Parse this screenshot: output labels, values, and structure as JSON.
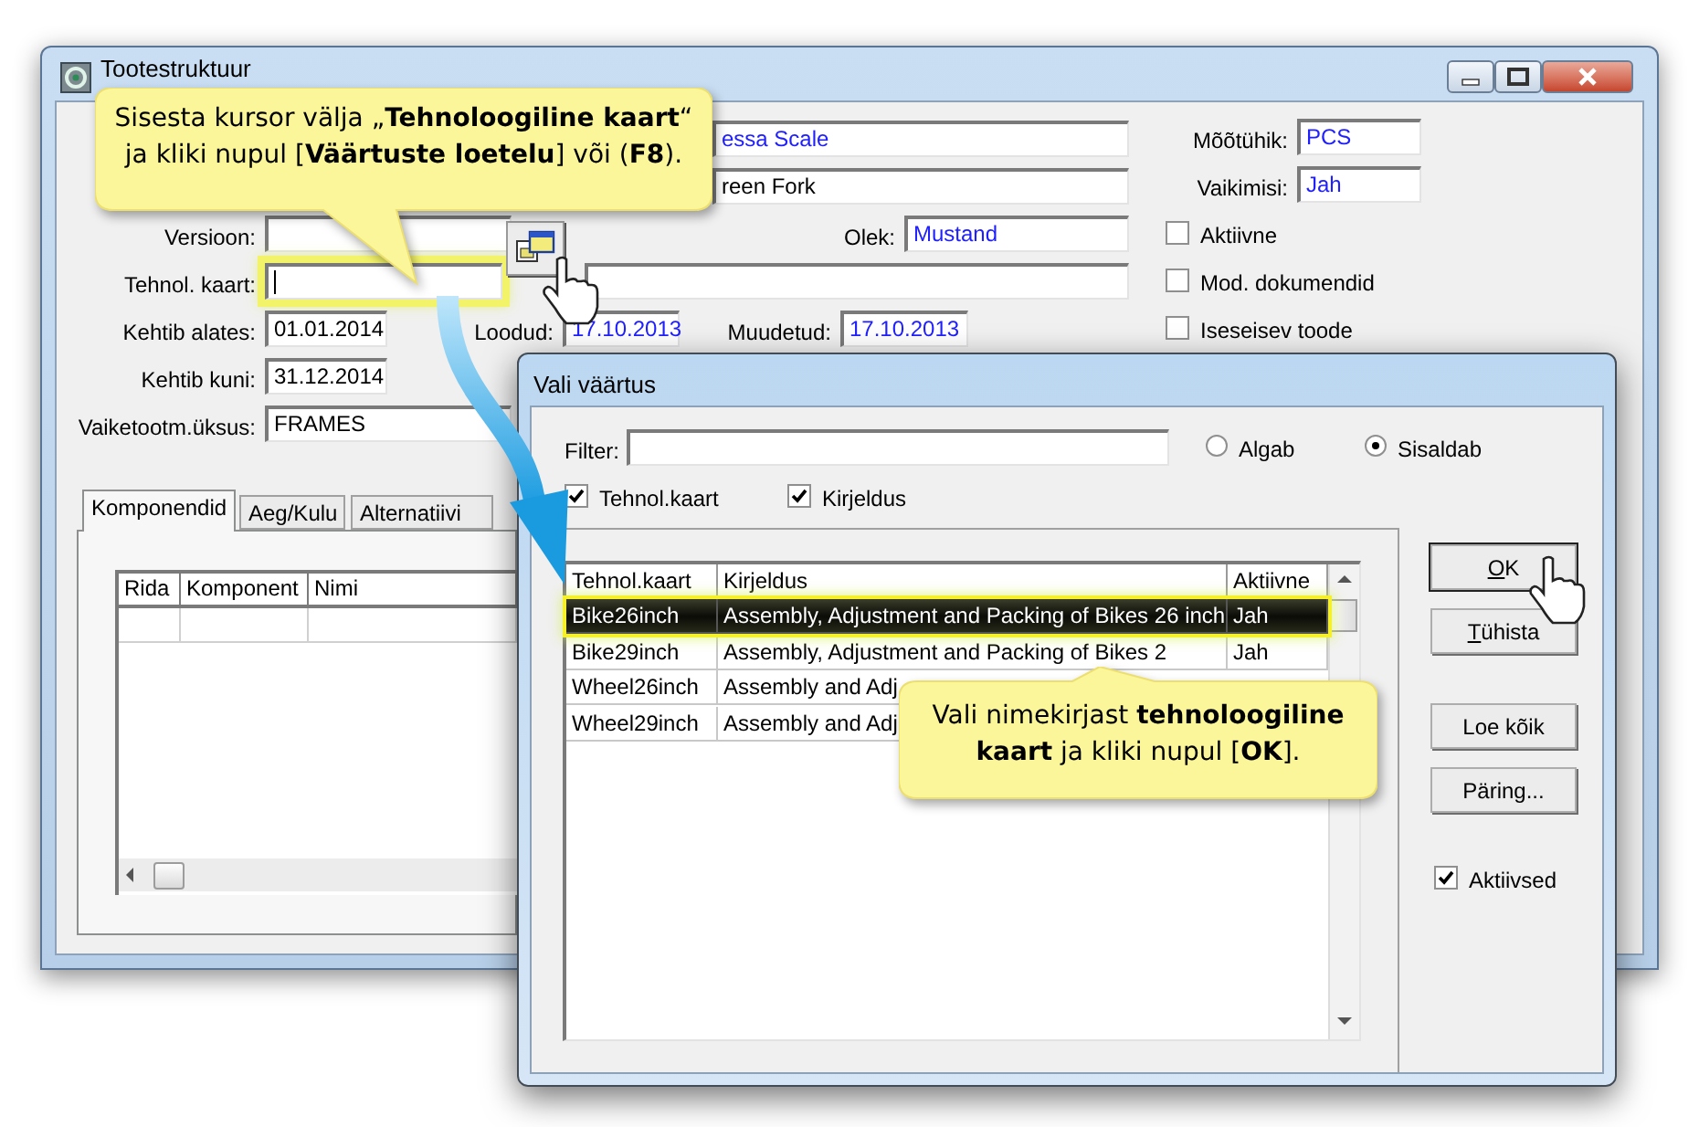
{
  "main_window": {
    "title": "Tootestruktuur",
    "fields": [
      {
        "value": "essa Scale",
        "kind": "display",
        "highlighted": false
      },
      {
        "value": "reen Fork",
        "kind": "input",
        "highlighted": false
      },
      {
        "label": "Mõõtühik:",
        "value": "PCS",
        "kind": "display",
        "highlighted": false
      },
      {
        "label": "Vaikimisi:",
        "value": "Jah",
        "kind": "display",
        "highlighted": false
      },
      {
        "label": "Versioon:",
        "kind": "display",
        "highlighted": false
      },
      {
        "label": "Olek:",
        "value": "Mustand",
        "kind": "display",
        "highlighted": false
      },
      {
        "label": "Tehnol. kaart:",
        "kind": "input",
        "highlighted": true
      },
      {
        "kind": "input",
        "highlighted": false
      },
      {
        "label": "Kehtib alates:",
        "value": "01.01.2014",
        "kind": "input",
        "highlighted": false
      },
      {
        "label": "Loodud:",
        "value": "17.10.2013",
        "kind": "display",
        "highlighted": false
      },
      {
        "label": "Muudetud:",
        "value": "17.10.2013",
        "kind": "display",
        "highlighted": false
      },
      {
        "label": "Kehtib kuni:",
        "value": "31.12.2014",
        "kind": "input",
        "highlighted": false
      },
      {
        "label": "Vaiketootm.üksus:",
        "value": "FRAMES",
        "kind": "input",
        "highlighted": false
      }
    ],
    "checkboxes": [
      {
        "label": "Aktiivne",
        "checked": false
      },
      {
        "label": "Mod. dokumendid",
        "checked": false
      },
      {
        "label": "Iseseisev toode",
        "checked": false
      }
    ],
    "tabs": [
      {
        "label": "Komponendid",
        "selected": true
      },
      {
        "label": "Aeg/Kulu",
        "selected": false
      },
      {
        "label": "Alternatiivi",
        "selected": false
      }
    ],
    "components_table": {
      "columns": [
        "Rida",
        "Komponent",
        "Nimi"
      ]
    }
  },
  "dialog": {
    "title": "Vali väärtus",
    "filter": {
      "label": "Filter:"
    },
    "match_mode": [
      {
        "label": "Algab",
        "selected": false
      },
      {
        "label": "Sisaldab",
        "selected": true
      }
    ],
    "search_in": [
      {
        "label": "Tehnol.kaart",
        "checked": true
      },
      {
        "label": "Kirjeldus",
        "checked": true
      }
    ],
    "table": {
      "columns": [
        "Tehnol.kaart",
        "Kirjeldus",
        "Aktiivne"
      ],
      "rows": [
        {
          "cells": [
            "Bike26inch",
            "Assembly, Adjustment and Packing of Bikes 26 inch",
            "Jah"
          ],
          "selected": true
        },
        {
          "cells": [
            "Bike29inch",
            "Assembly, Adjustment and Packing of Bikes 2",
            "Jah"
          ],
          "selected": false
        },
        {
          "cells": [
            "Wheel26inch",
            "Assembly and Adj"
          ],
          "selected": false
        },
        {
          "cells": [
            "Wheel29inch",
            "Assembly and Adj"
          ],
          "selected": false
        }
      ]
    },
    "buttons": [
      {
        "label": "OK",
        "default": true,
        "access_key_underlined": true
      },
      {
        "label": "Tühista",
        "default": false,
        "access_key_underlined": true
      },
      {
        "label": "Loe kõik",
        "default": false,
        "access_key_underlined": false
      },
      {
        "label": "Päring...",
        "default": false,
        "access_key_underlined": false
      }
    ],
    "active_only": {
      "label": "Aktiivsed",
      "checked": true
    }
  },
  "callouts": [
    {
      "text": "Sisesta kursor välja „**Tehnoloogiline  kaart**“\nja kliki nupul [**Väärtuste loetelu**] või (**F8**)."
    },
    {
      "text": "Vali nimekirjast **tehnoloogiline**\n**kaart** ja kliki nupul [**OK**]."
    }
  ]
}
